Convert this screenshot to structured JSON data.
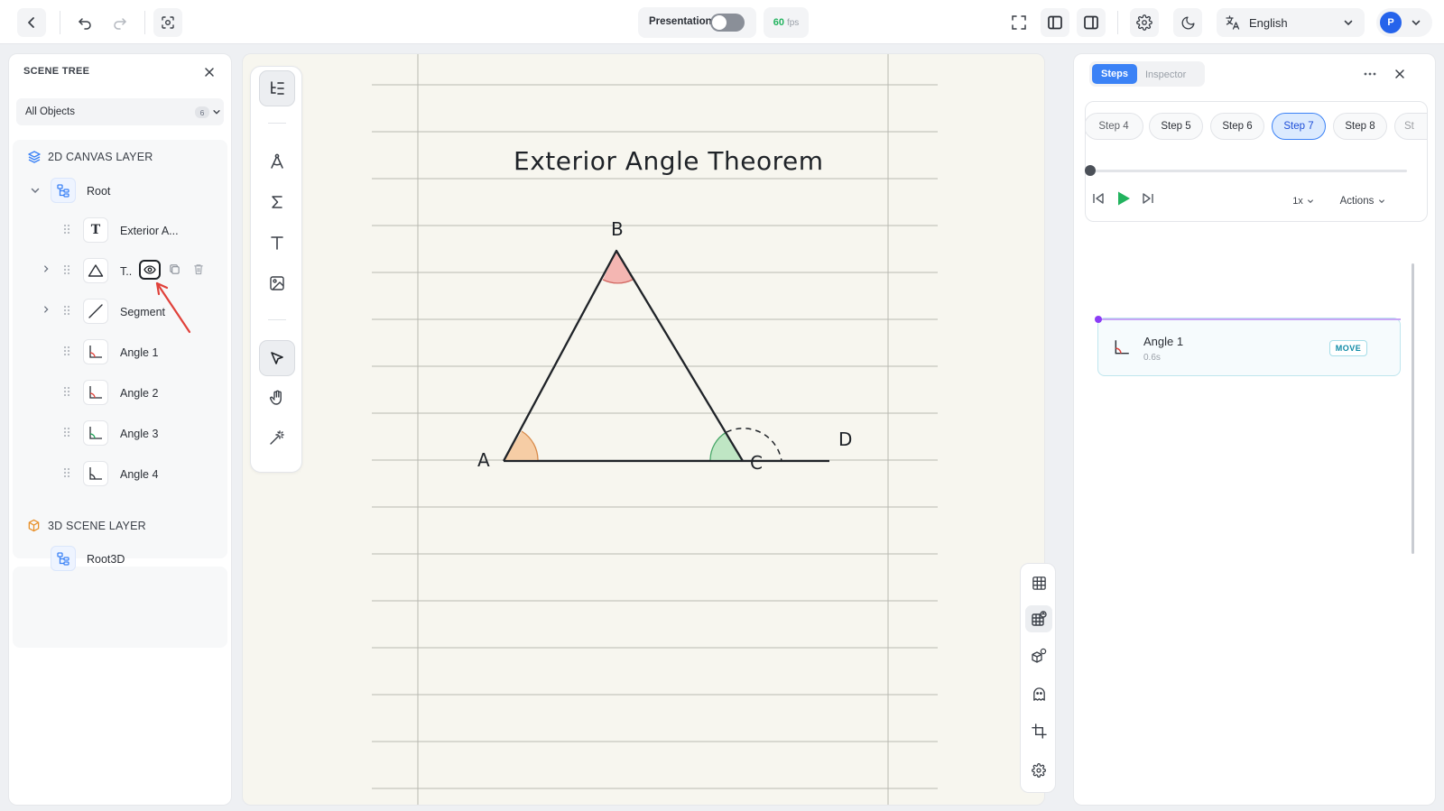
{
  "topbar": {
    "presentation_label": "Presentation",
    "fps_value": "60",
    "fps_unit": "fps",
    "language": "English",
    "avatar_initial": "P"
  },
  "scene_tree": {
    "title": "SCENE TREE",
    "filter_label": "All Objects",
    "filter_count": "6",
    "layer_2d": "2D CANVAS LAYER",
    "root_label": "Root",
    "items": [
      {
        "label": "Exterior A...",
        "icon": "text-icon"
      },
      {
        "label": "T..",
        "icon": "triangle-icon"
      },
      {
        "label": "Segment",
        "icon": "segment-icon"
      },
      {
        "label": "Angle 1",
        "icon": "angle-icon"
      },
      {
        "label": "Angle 2",
        "icon": "angle-icon"
      },
      {
        "label": "Angle 3",
        "icon": "angle-icon"
      },
      {
        "label": "Angle 4",
        "icon": "angle-icon"
      }
    ],
    "layer_3d": "3D SCENE LAYER",
    "root3d_label": "Root3D"
  },
  "canvas": {
    "title": "Exterior Angle Theorem",
    "points": {
      "a": "A",
      "b": "B",
      "c": "C",
      "d": "D"
    }
  },
  "steps_panel": {
    "tab_steps": "Steps",
    "tab_inspector": "Inspector",
    "step_chips": [
      "Step 4",
      "Step 5",
      "Step 6",
      "Step 7",
      "Step 8",
      "St"
    ],
    "active_step": "Step 7",
    "speed": "1x",
    "actions_label": "Actions",
    "timeline_item": {
      "title": "Angle 1",
      "duration": "0.6s",
      "badge": "MOVE"
    }
  },
  "colors": {
    "accent_blue": "#3b82f6",
    "play_green": "#22b35e",
    "angle_b_fill": "#f4b6b2",
    "angle_a_fill": "#f6cda5",
    "angle_c_fill": "#bfe6c4",
    "annotation_red": "#e0413a"
  }
}
